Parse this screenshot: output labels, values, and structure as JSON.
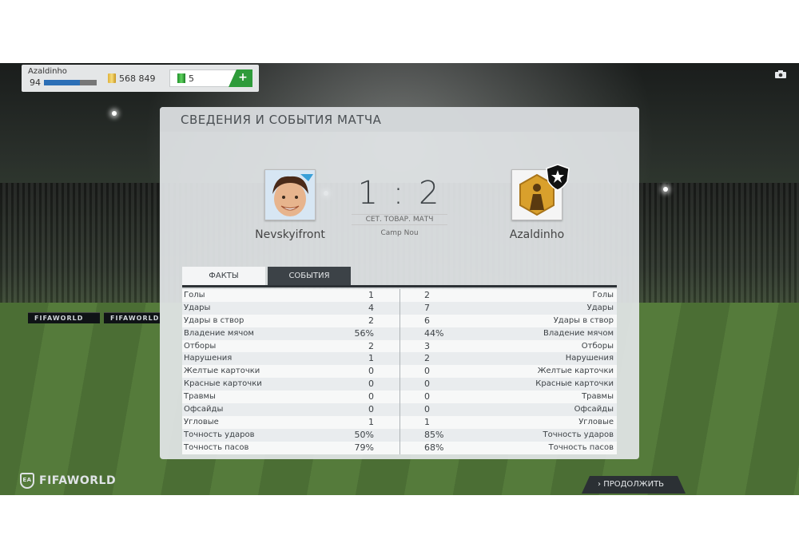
{
  "topbar": {
    "player_name": "Azaldinho",
    "player_rating": "94",
    "xp_fraction": 0.68,
    "coins": "568 849",
    "points": "5",
    "add_label": "+"
  },
  "panel": {
    "title": "СВЕДЕНИЯ И СОБЫТИЯ МАТЧА",
    "home_team": "Nevskyifront",
    "away_team": "Azaldinho",
    "score": "1 : 2",
    "match_type": "СЕТ. ТОВАР. МАТЧ",
    "stadium": "Camp Nou"
  },
  "tabs": [
    {
      "label": "ФАКТЫ",
      "active": true
    },
    {
      "label": "СОБЫТИЯ",
      "active": false
    }
  ],
  "stats": [
    {
      "label": "Голы",
      "home": "1",
      "away": "2"
    },
    {
      "label": "Удары",
      "home": "4",
      "away": "7"
    },
    {
      "label": "Удары в створ",
      "home": "2",
      "away": "6"
    },
    {
      "label": "Владение мячом",
      "home": "56%",
      "away": "44%"
    },
    {
      "label": "Отборы",
      "home": "2",
      "away": "3"
    },
    {
      "label": "Нарушения",
      "home": "1",
      "away": "2"
    },
    {
      "label": "Желтые карточки",
      "home": "0",
      "away": "0"
    },
    {
      "label": "Красные карточки",
      "home": "0",
      "away": "0"
    },
    {
      "label": "Травмы",
      "home": "0",
      "away": "0"
    },
    {
      "label": "Офсайды",
      "home": "0",
      "away": "0"
    },
    {
      "label": "Угловые",
      "home": "1",
      "away": "1"
    },
    {
      "label": "Точность ударов",
      "home": "50%",
      "away": "85%"
    },
    {
      "label": "Точность пасов",
      "home": "79%",
      "away": "68%"
    }
  ],
  "footer": {
    "logo_text": "FIFAWORLD",
    "logo_badge": "EA",
    "continue_label": "ПРОДОЛЖИТЬ"
  },
  "background_ads": [
    "FIFAWORLD",
    "FIFAWORLD"
  ],
  "colors": {
    "accent_green": "#2e9b3a",
    "xp_blue": "#2c6fb6",
    "dark_tab": "#3c4247"
  }
}
